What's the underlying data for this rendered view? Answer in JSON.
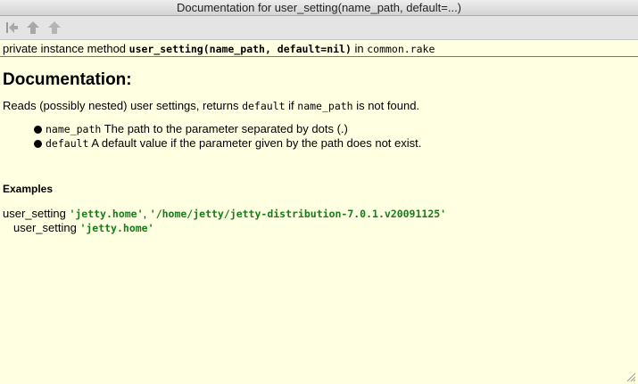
{
  "window": {
    "title": "Documentation for user_setting(name_path, default=...)"
  },
  "toolbar": {
    "back_icon": "arrow-left-icon",
    "forward_icon": "arrow-right-icon",
    "up_icon": "arrow-up-icon"
  },
  "signature": {
    "prefix": "private instance method ",
    "method": "user_setting(name_path, default=nil)",
    "in_text": " in ",
    "file": "common.rake"
  },
  "doc": {
    "heading": "Documentation:",
    "desc_part1": "Reads (possibly nested) user settings, returns ",
    "desc_code1": "default",
    "desc_part2": " if ",
    "desc_code2": "name_path",
    "desc_part3": " is not found.",
    "params": [
      {
        "name": "name_path",
        "text": " The path to the parameter separated by dots (.)"
      },
      {
        "name": "default",
        "text": " A default value if the parameter given by the path does not exist."
      }
    ],
    "examples_heading": "Examples",
    "examples": [
      {
        "call": "user_setting ",
        "arg1": "'jetty.home'",
        "sep": ", ",
        "arg2": "'/home/jetty/jetty-distribution-7.0.1.v20091125'"
      },
      {
        "call": "user_setting ",
        "arg1": "'jetty.home'"
      }
    ]
  }
}
